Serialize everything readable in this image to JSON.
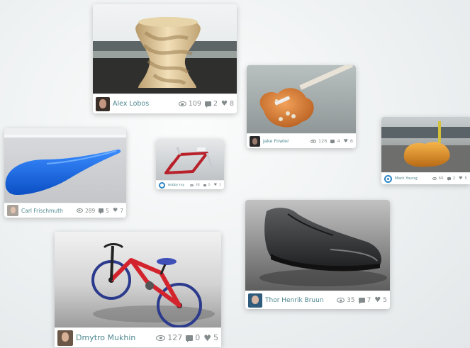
{
  "cards": [
    {
      "id": "vase",
      "author": "Alex Lobos",
      "views": "109",
      "comments": "2",
      "likes": "8"
    },
    {
      "id": "guitar",
      "author": "Jake Fowler",
      "views": "126",
      "comments": "4",
      "likes": "6"
    },
    {
      "id": "chair",
      "author": "Mark Young",
      "views": "66",
      "comments": "2",
      "likes": "5"
    },
    {
      "id": "surf",
      "author": "Carl Frischmuth",
      "views": "289",
      "comments": "5",
      "likes": "7"
    },
    {
      "id": "frame",
      "author": "Bobby Fay",
      "views": "48",
      "comments": "0",
      "likes": "1"
    },
    {
      "id": "shoe",
      "author": "Thor Henrik Bruun",
      "views": "35",
      "comments": "7",
      "likes": "5"
    },
    {
      "id": "bike",
      "author": "Dmytro Mukhin",
      "views": "127",
      "comments": "0",
      "likes": "5"
    }
  ]
}
